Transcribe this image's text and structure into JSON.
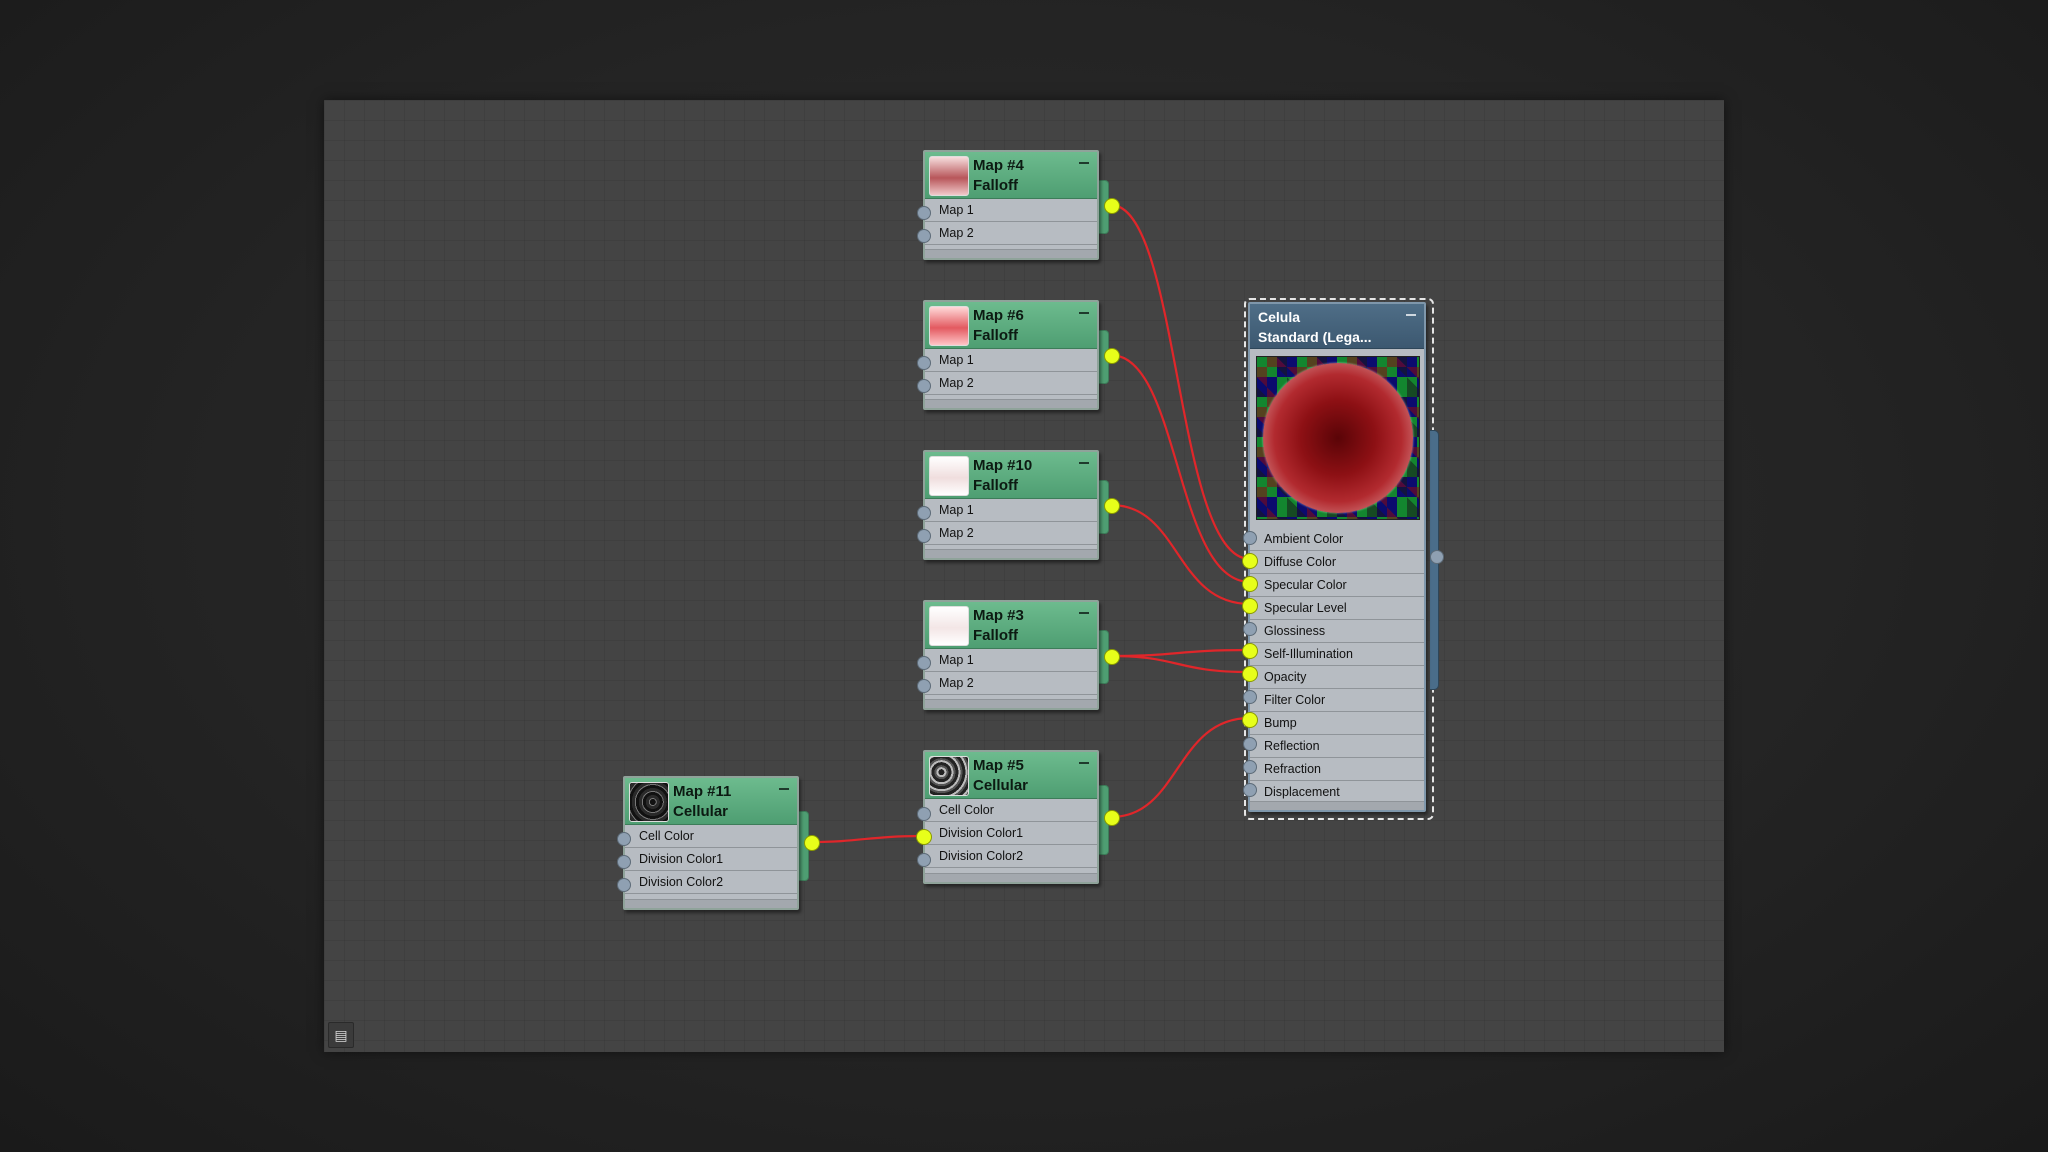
{
  "nodes": {
    "map4": {
      "title1": "Map #4",
      "title2": "Falloff",
      "slots": [
        "Map 1",
        "Map 2"
      ]
    },
    "map6": {
      "title1": "Map #6",
      "title2": "Falloff",
      "slots": [
        "Map 1",
        "Map 2"
      ]
    },
    "map10": {
      "title1": "Map #10",
      "title2": "Falloff",
      "slots": [
        "Map 1",
        "Map 2"
      ]
    },
    "map3": {
      "title1": "Map #3",
      "title2": "Falloff",
      "slots": [
        "Map 1",
        "Map 2"
      ]
    },
    "map5": {
      "title1": "Map #5",
      "title2": "Cellular",
      "slots": [
        "Cell Color",
        "Division Color1",
        "Division Color2"
      ]
    },
    "map11": {
      "title1": "Map #11",
      "title2": "Cellular",
      "slots": [
        "Cell Color",
        "Division Color1",
        "Division Color2"
      ]
    }
  },
  "material": {
    "title1": "Celula",
    "title2": "Standard  (Lega...",
    "slots": [
      "Ambient Color",
      "Diffuse Color",
      "Specular Color",
      "Specular Level",
      "Glossiness",
      "Self-Illumination",
      "Opacity",
      "Filter Color",
      "Bump",
      "Reflection",
      "Refraction",
      "Displacement"
    ]
  },
  "colors": {
    "wire": "#e0262a",
    "socket_connected": "#e7ff1a",
    "socket_empty": "#8fa0b2",
    "map_header": "#5aa97d",
    "material_header": "#46647c"
  },
  "toolbar": {
    "corner_icon": "navigator-icon"
  }
}
